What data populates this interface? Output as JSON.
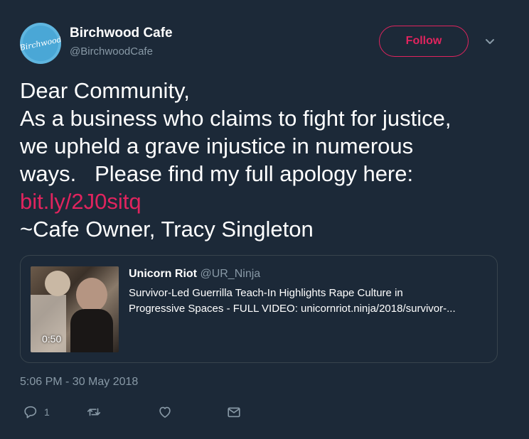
{
  "user": {
    "display_name": "Birchwood Cafe",
    "handle": "@BirchwoodCafe",
    "avatar_text": "Birchwood"
  },
  "follow": {
    "label": "Follow"
  },
  "tweet": {
    "lines": [
      "Dear Community,",
      "As a business who claims to fight for justice,",
      "we upheld a grave injustice in numerous",
      "ways.   Please find my full apology here:"
    ],
    "link": "bit.ly/2J0sitq",
    "signature": "~Cafe Owner, Tracy Singleton"
  },
  "card": {
    "author_name": "Unicorn Riot",
    "author_handle": "@UR_Ninja",
    "body_lines": [
      "Survivor-Led Guerrilla Teach-In Highlights Rape Culture in",
      "Progressive Spaces - FULL VIDEO: unicornriot.ninja/2018/survivor-..."
    ],
    "duration": "0:50"
  },
  "timestamp": "5:06 PM - 30 May 2018",
  "actions": {
    "reply_count": "1"
  },
  "colors": {
    "background": "#1c2938",
    "accent": "#e0245e",
    "muted": "#8899a6",
    "border": "#38444d"
  },
  "icons": [
    "chevron-down-icon",
    "reply-icon",
    "retweet-icon",
    "like-icon",
    "message-icon"
  ]
}
